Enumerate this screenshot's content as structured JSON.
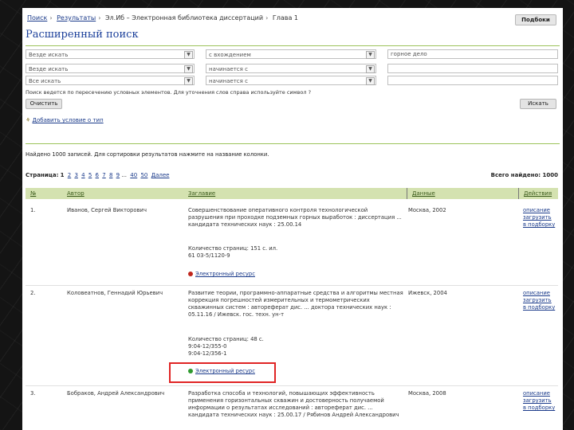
{
  "breadcrumb": [
    "Поиск",
    "Результаты",
    "Эл.Иб – Электронная библиотека диссертаций",
    "Глава 1"
  ],
  "subscribe_label": "Подбоки",
  "title": "Расширенный поиск",
  "search_rows": [
    {
      "field": "Везде искать",
      "op": "с вхождением",
      "value": "горное дело"
    },
    {
      "field": "Везде искать",
      "op": "начинается с",
      "value": ""
    },
    {
      "field": "Все искать",
      "op": "начинается с",
      "value": ""
    }
  ],
  "hint": "Поиск ведется по пересечению условных элементов. Для уточнения слов справа используйте символ ?",
  "clear_label": "Очистить",
  "search_label": "Искать",
  "add_condition_label": "Добавить условие о тип",
  "found_text": "Найдено 1000 записей. Для сортировки результатов нажмите на название колонки.",
  "pager": {
    "label": "Страница:",
    "current": "1",
    "pages": [
      "2",
      "3",
      "4",
      "5",
      "6",
      "7",
      "8",
      "9",
      "...",
      "40",
      "50",
      "Далее"
    ]
  },
  "total_text": "Всего найдено: 1000",
  "columns": [
    "№",
    "Автор",
    "Заглавие",
    "Данные",
    "Действия"
  ],
  "rows": [
    {
      "num": "1.",
      "author": "Иванов, Сергей Викторович",
      "title_lines": [
        "Совершенствование оперативного контроля технологической",
        "разрушения при проходке подземных горных выработок : диссертация ...",
        "кандидата технических наук : 25.00.14"
      ],
      "extra_lines": [
        "Количество страниц: 151 с. ил.",
        "61 03-5/1120-9"
      ],
      "resource": "Электронный ресурс",
      "resource_color": "#c0261c",
      "data": "Москва, 2002",
      "actions": [
        "описание",
        "загрузить",
        "в подборку"
      ]
    },
    {
      "num": "2.",
      "author": "Коловеатнов, Геннадий Юрьевич",
      "title_lines": [
        "Развитие теории, программно-аппаратные средства и алгоритмы местная",
        "коррекция погрешностей измерительных и термометрических",
        "скважинных систем : автореферат дис. ... доктора технических наук :",
        "05.11.16 / Ижевск. гос. техн. ун-т"
      ],
      "extra_lines": [
        "Количество страниц: 48 с.",
        "9:04-12/355-0",
        "9:04-12/356-1"
      ],
      "resource": "Электронный ресурс",
      "resource_color": "#2e9a2e",
      "data": "Ижевск, 2004",
      "actions": [
        "описание",
        "загрузить",
        "в подборку"
      ]
    },
    {
      "num": "3.",
      "author": "Бобраков, Андрей Александрович",
      "title_lines": [
        "Разработка способа и технологий, повышающих эффективность",
        "применения горизонтальных скважин и достоверность получаемой",
        "информации о результатах исследований : автореферат дис. ...",
        "кандидата технических наук : 25.00.17 / Рябинов Андрей Александрович"
      ],
      "extra_lines": [],
      "resource": "",
      "resource_color": "",
      "data": "Москва, 2008",
      "actions": [
        "описание",
        "загрузить",
        "в подборку"
      ]
    }
  ],
  "colors": {
    "accent_green": "#d4e2b0",
    "link": "#1a3a8a",
    "title_blue": "#1b3f9a",
    "highlight_red": "#e02424"
  }
}
